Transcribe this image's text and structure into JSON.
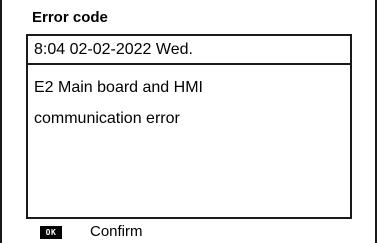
{
  "title": "Error code",
  "datetime": "8:04  02-02-2022  Wed.",
  "message": {
    "line1": "E2  Main board and HMI",
    "line2": "communication error"
  },
  "footer": {
    "ok_key": "OK",
    "confirm_label": "Confirm"
  },
  "colors": {
    "background": "#ffffff",
    "text": "#000000",
    "border": "#1a1a1a",
    "key_background": "#000000",
    "key_text": "#ffffff"
  }
}
